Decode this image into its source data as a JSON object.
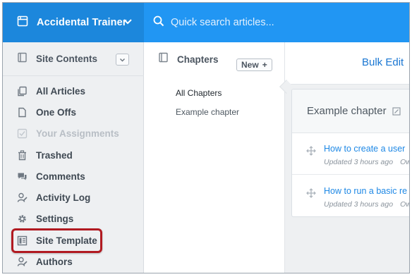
{
  "topbar": {
    "site_name": "Accidental Trainer",
    "search_placeholder": "Quick search articles..."
  },
  "sidebar": {
    "header_label": "Site Contents",
    "items": [
      {
        "label": "All Articles",
        "icon": "articles-icon",
        "disabled": false
      },
      {
        "label": "One Offs",
        "icon": "document-icon",
        "disabled": false
      },
      {
        "label": "Your Assignments",
        "icon": "checkbox-icon",
        "disabled": true
      },
      {
        "label": "Trashed",
        "icon": "trash-icon",
        "disabled": false
      },
      {
        "label": "Comments",
        "icon": "comments-icon",
        "disabled": false
      },
      {
        "label": "Activity Log",
        "icon": "activity-log-icon",
        "disabled": false
      },
      {
        "label": "Settings",
        "icon": "gear-icon",
        "disabled": false
      },
      {
        "label": "Site Template",
        "icon": "template-icon",
        "disabled": false
      },
      {
        "label": "Authors",
        "icon": "authors-icon",
        "disabled": false
      }
    ],
    "highlighted_item": "Site Template",
    "highlight_color": "#b11a21"
  },
  "chapters": {
    "header_label": "Chapters",
    "new_button_label": "New",
    "items": [
      {
        "label": "All Chapters",
        "active": true
      },
      {
        "label": "Example chapter",
        "active": false
      }
    ]
  },
  "content": {
    "bulk_edit_label": "Bulk Edit",
    "chapter_title": "Example chapter",
    "articles": [
      {
        "title": "How to create a user",
        "updated": "Updated 3 hours ago",
        "owner": "Ow"
      },
      {
        "title": "How to run a basic re",
        "updated": "Updated 3 hours ago",
        "owner": "Ow"
      }
    ]
  },
  "colors": {
    "topbar": "#2196f3",
    "site_switch": "#1c87dc",
    "link": "#1e88e5",
    "sidebar_bg": "#eef0f2"
  }
}
